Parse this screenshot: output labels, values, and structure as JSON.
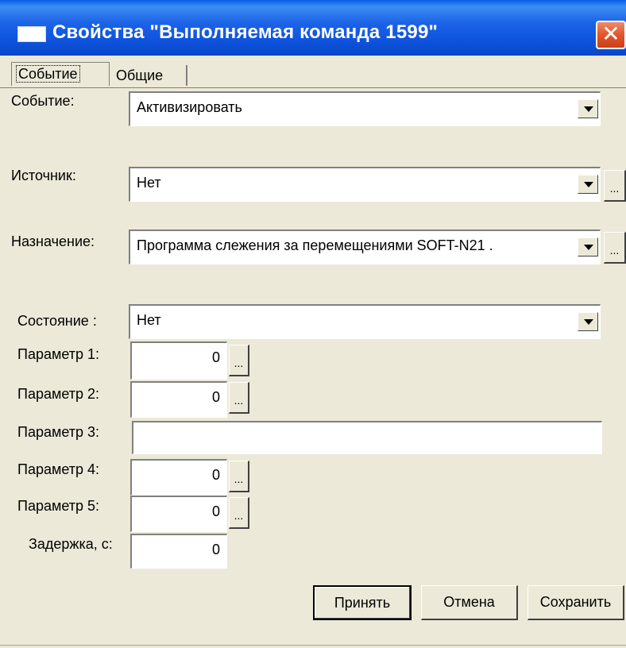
{
  "window": {
    "title": "Свойства  \"Выполняемая команда 1599\"",
    "close_glyph": "✕"
  },
  "tabs": [
    {
      "label": "Событие",
      "active": true
    },
    {
      "label": "Общие",
      "active": false
    }
  ],
  "fields": {
    "event": {
      "label": "Событие:",
      "value": "Активизировать"
    },
    "source": {
      "label": "Источник:",
      "value": "Нет",
      "browse": "..."
    },
    "destination": {
      "label": "Назначение:",
      "value": "Программа слежения за перемещениями SOFT-N21 .",
      "browse": "..."
    },
    "state": {
      "label": "Состояние :",
      "value": "Нет"
    },
    "param1": {
      "label": "Параметр 1:",
      "value": "0",
      "browse": "..."
    },
    "param2": {
      "label": "Параметр 2:",
      "value": "0",
      "browse": "..."
    },
    "param3": {
      "label": "Параметр 3:",
      "value": ""
    },
    "param4": {
      "label": "Параметр 4:",
      "value": "0",
      "browse": "..."
    },
    "param5": {
      "label": "Параметр 5:",
      "value": "0",
      "browse": "..."
    },
    "delay": {
      "label": "Задержка, с:",
      "value": "0"
    }
  },
  "buttons": {
    "accept": "Принять",
    "cancel": "Отмена",
    "save": "Сохранить"
  },
  "colors": {
    "titlebar": "#0d52dc",
    "dialog_bg": "#ece9d8",
    "close_button": "#e2552d"
  }
}
